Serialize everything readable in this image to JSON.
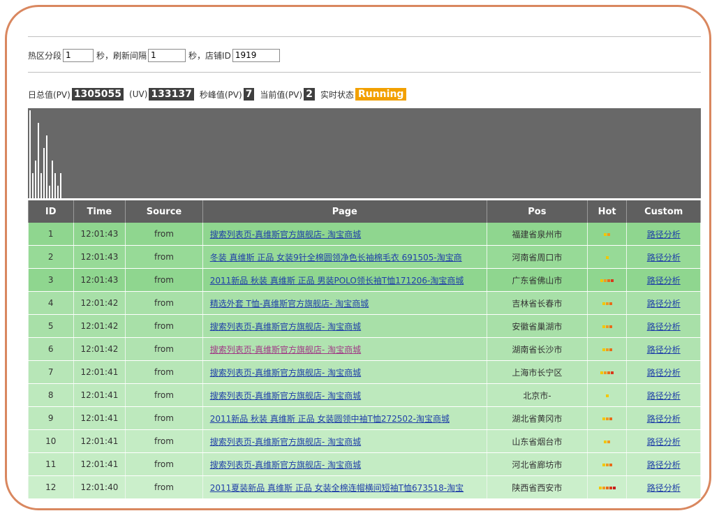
{
  "controls": {
    "segment_label": "热区分段",
    "segment_value": "1",
    "seconds_label_1": "秒，刷新间隔",
    "interval_value": "1",
    "seconds_label_2": "秒，店铺ID",
    "shop_id_value": "1919"
  },
  "stats": {
    "daily_pv_label": "日总值(PV)",
    "daily_pv_value": "1305055",
    "uv_label": "(UV)",
    "uv_value": "133137",
    "peak_label": "秒峰值(PV)",
    "peak_value": "7",
    "current_label": "当前值(PV)",
    "current_value": "2",
    "status_label": "实时状态",
    "status_value": "Running"
  },
  "chart_data": {
    "type": "bar",
    "values": [
      7,
      2,
      3,
      6,
      2,
      4,
      5,
      1,
      3,
      2,
      1,
      2
    ],
    "ylim": [
      0,
      7
    ],
    "colors": {
      "background": "#686868",
      "bar": "#ffffff"
    }
  },
  "table": {
    "headers": [
      "ID",
      "Time",
      "Source",
      "Page",
      "Pos",
      "Hot",
      "Custom"
    ],
    "rows": [
      {
        "id": "1",
        "time": "12:01:43",
        "source": "from",
        "page": "搜索列表页-真维斯官方旗舰店- 淘宝商城",
        "pos": "福建省泉州市",
        "hot": 2,
        "custom": "路径分析",
        "bg": "#8fd68f",
        "visited": false
      },
      {
        "id": "2",
        "time": "12:01:43",
        "source": "from",
        "page": "冬装 真维斯 正品 女装9针全棉圆领净色长袖棉毛衣 691505-淘宝商",
        "pos": "河南省周口市",
        "hot": 1,
        "custom": "路径分析",
        "bg": "#97da97",
        "visited": false
      },
      {
        "id": "3",
        "time": "12:01:43",
        "source": "from",
        "page": "2011新品 秋装 真维斯 正品 男装POLO领长袖T恤171206-淘宝商城",
        "pos": "广东省佛山市",
        "hot": 4,
        "custom": "路径分析",
        "bg": "#8fd68f",
        "visited": false
      },
      {
        "id": "4",
        "time": "12:01:42",
        "source": "from",
        "page": "精选外套 T恤-真维斯官方旗舰店- 淘宝商城",
        "pos": "吉林省长春市",
        "hot": 3,
        "custom": "路径分析",
        "bg": "#a8e0a8",
        "visited": false
      },
      {
        "id": "5",
        "time": "12:01:42",
        "source": "from",
        "page": "搜索列表页-真维斯官方旗舰店- 淘宝商城",
        "pos": "安徽省巢湖市",
        "hot": 3,
        "custom": "路径分析",
        "bg": "#a8e0a8",
        "visited": false
      },
      {
        "id": "6",
        "time": "12:01:42",
        "source": "from",
        "page": "搜索列表页-真维斯官方旗舰店- 淘宝商城",
        "pos": "湖南省长沙市",
        "hot": 3,
        "custom": "路径分析",
        "bg": "#b0e3b0",
        "visited": true
      },
      {
        "id": "7",
        "time": "12:01:41",
        "source": "from",
        "page": "搜索列表页-真维斯官方旗舰店- 淘宝商城",
        "pos": "上海市长宁区",
        "hot": 4,
        "custom": "路径分析",
        "bg": "#b7e6b7",
        "visited": false
      },
      {
        "id": "8",
        "time": "12:01:41",
        "source": "from",
        "page": "搜索列表页-真维斯官方旗舰店- 淘宝商城",
        "pos": "北京市-",
        "hot": 1,
        "custom": "路径分析",
        "bg": "#bde9bd",
        "visited": false
      },
      {
        "id": "9",
        "time": "12:01:41",
        "source": "from",
        "page": "2011新品 秋装 真维斯 正品 女装圆领中袖T恤272502-淘宝商城",
        "pos": "湖北省黄冈市",
        "hot": 3,
        "custom": "路径分析",
        "bg": "#bde9bd",
        "visited": false
      },
      {
        "id": "10",
        "time": "12:01:41",
        "source": "from",
        "page": "搜索列表页-真维斯官方旗舰店- 淘宝商城",
        "pos": "山东省烟台市",
        "hot": 2,
        "custom": "路径分析",
        "bg": "#c4ecc4",
        "visited": false
      },
      {
        "id": "11",
        "time": "12:01:41",
        "source": "from",
        "page": "搜索列表页-真维斯官方旗舰店- 淘宝商城",
        "pos": "河北省廊坊市",
        "hot": 3,
        "custom": "路径分析",
        "bg": "#c4ecc4",
        "visited": false
      },
      {
        "id": "12",
        "time": "12:01:40",
        "source": "from",
        "page": "2011夏装新品 真维斯 正品 女装全棉连帽横间短袖T恤673518-淘宝",
        "pos": "陕西省西安市",
        "hot": 5,
        "custom": "路径分析",
        "bg": "#cbefcb",
        "visited": false
      }
    ]
  }
}
